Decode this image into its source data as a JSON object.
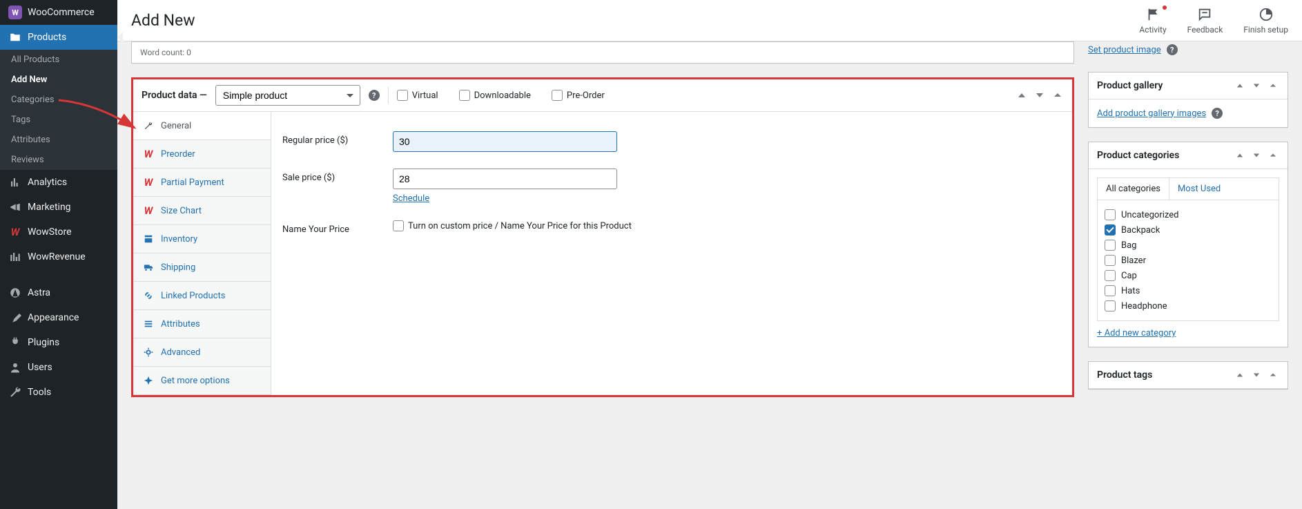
{
  "sidebar": {
    "wc_label": "WooCommerce",
    "products_label": "Products",
    "sub": {
      "all": "All Products",
      "add": "Add New",
      "cats": "Categories",
      "tags": "Tags",
      "attrs": "Attributes",
      "reviews": "Reviews"
    },
    "analytics": "Analytics",
    "marketing": "Marketing",
    "wowstore": "WowStore",
    "wowrevenue": "WowRevenue",
    "astra": "Astra",
    "appearance": "Appearance",
    "plugins": "Plugins",
    "users": "Users",
    "tools": "Tools"
  },
  "topbar": {
    "title": "Add New",
    "activity": "Activity",
    "feedback": "Feedback",
    "finish": "Finish setup"
  },
  "wordcount": "Word count: 0",
  "product_data": {
    "header_label": "Product data —",
    "type_selected": "Simple product",
    "virtual": "Virtual",
    "downloadable": "Downloadable",
    "preorder": "Pre-Order",
    "tabs": {
      "general": "General",
      "preorder": "Preorder",
      "partial": "Partial Payment",
      "sizechart": "Size Chart",
      "inventory": "Inventory",
      "shipping": "Shipping",
      "linked": "Linked Products",
      "attributes": "Attributes",
      "advanced": "Advanced",
      "more": "Get more options"
    },
    "form": {
      "regular_label": "Regular price ($)",
      "sale_label": "Sale price ($)",
      "regular_value": "30",
      "sale_value": "28",
      "schedule": "Schedule",
      "nyp_label": "Name Your Price",
      "nyp_desc": "Turn on custom price / Name Your Price for this Product"
    }
  },
  "right": {
    "set_image": "Set product image",
    "gallery_title": "Product gallery",
    "gallery_link": "Add product gallery images",
    "cats_title": "Product categories",
    "cat_tab_all": "All categories",
    "cat_tab_most": "Most Used",
    "categories": {
      "uncat": "Uncategorized",
      "backpack": "Backpack",
      "bag": "Bag",
      "blazer": "Blazer",
      "cap": "Cap",
      "hats": "Hats",
      "headphone": "Headphone"
    },
    "add_cat": "+ Add new category",
    "tags_title": "Product tags"
  }
}
